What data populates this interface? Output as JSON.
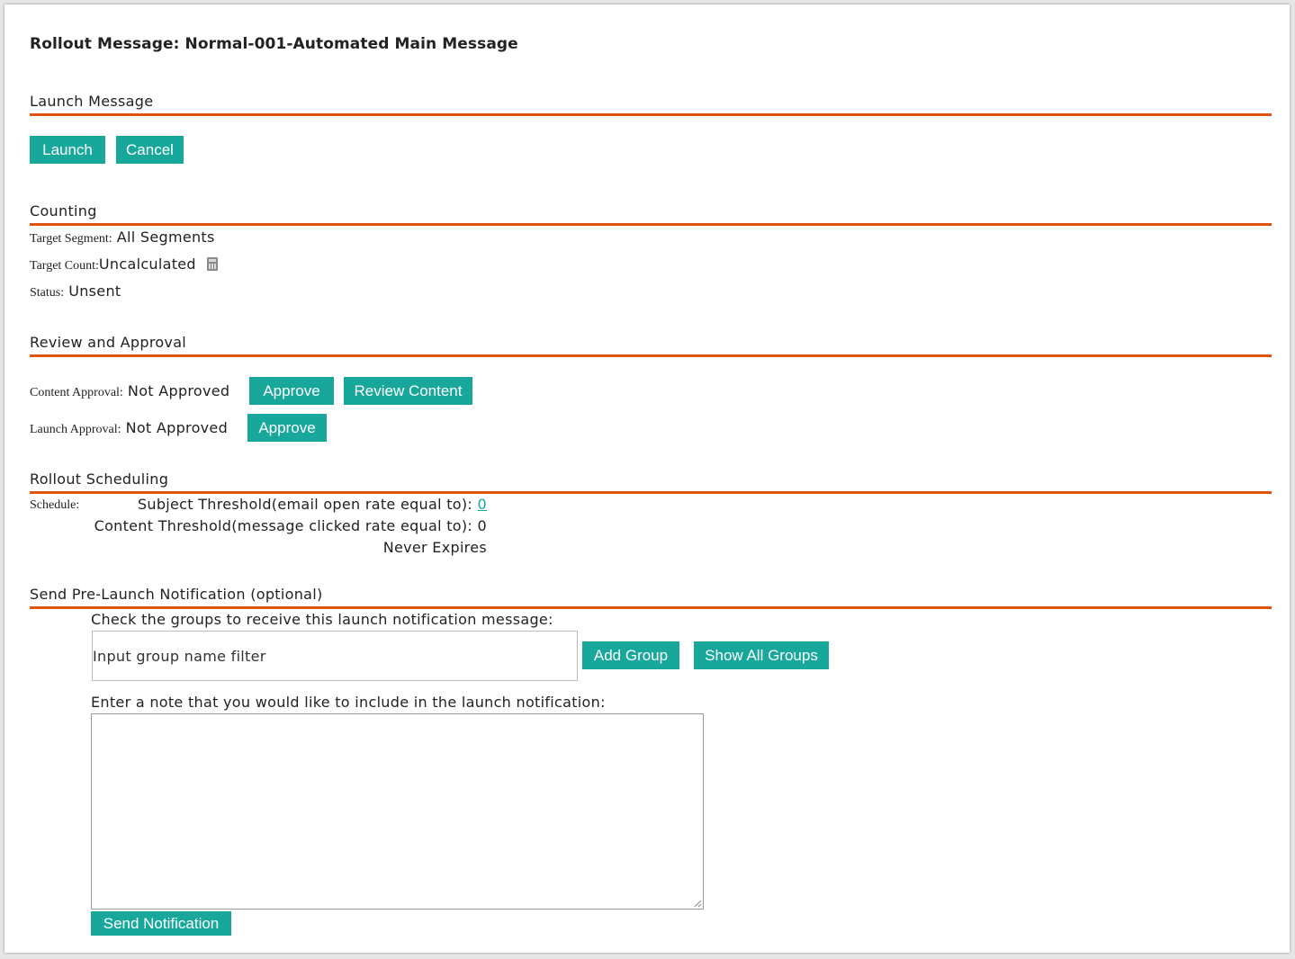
{
  "title": "Rollout Message: Normal-001-Automated Main Message",
  "sections": {
    "launch": "Launch Message",
    "counting": "Counting",
    "review": "Review and Approval",
    "scheduling": "Rollout Scheduling",
    "notification": "Send Pre-Launch Notification (optional)"
  },
  "launch": {
    "launch_label": "Launch",
    "cancel_label": "Cancel"
  },
  "counting": {
    "segment_label": "Target Segment:",
    "segment_value": "All Segments",
    "count_label": "Target Count:",
    "count_value": "Uncalculated",
    "status_label": "Status:",
    "status_value": "Unsent",
    "calculator_icon": "calculator-icon"
  },
  "review": {
    "content_label": "Content Approval:",
    "content_value": "Not Approved",
    "approve_label": "Approve",
    "review_content_label": "Review Content",
    "launch_label": "Launch Approval:",
    "launch_value": "Not Approved",
    "launch_approve_label": "Approve"
  },
  "scheduling": {
    "schedule_label": "Schedule:",
    "subject_threshold": "Subject Threshold(email open rate equal to):",
    "subject_value": "0",
    "content_threshold": "Content Threshold(message clicked rate equal to): 0",
    "expiry": "Never Expires"
  },
  "notification": {
    "groups_prompt": "Check the groups to receive this launch notification message:",
    "group_filter_placeholder": "Input group name filter",
    "add_group_label": "Add Group",
    "show_all_groups_label": "Show All Groups",
    "note_prompt": "Enter a note that you would like to include in the launch notification:",
    "note_value": "",
    "send_label": "Send Notification"
  },
  "colors": {
    "accent": "#17a79b",
    "divider": "#e0520f"
  }
}
